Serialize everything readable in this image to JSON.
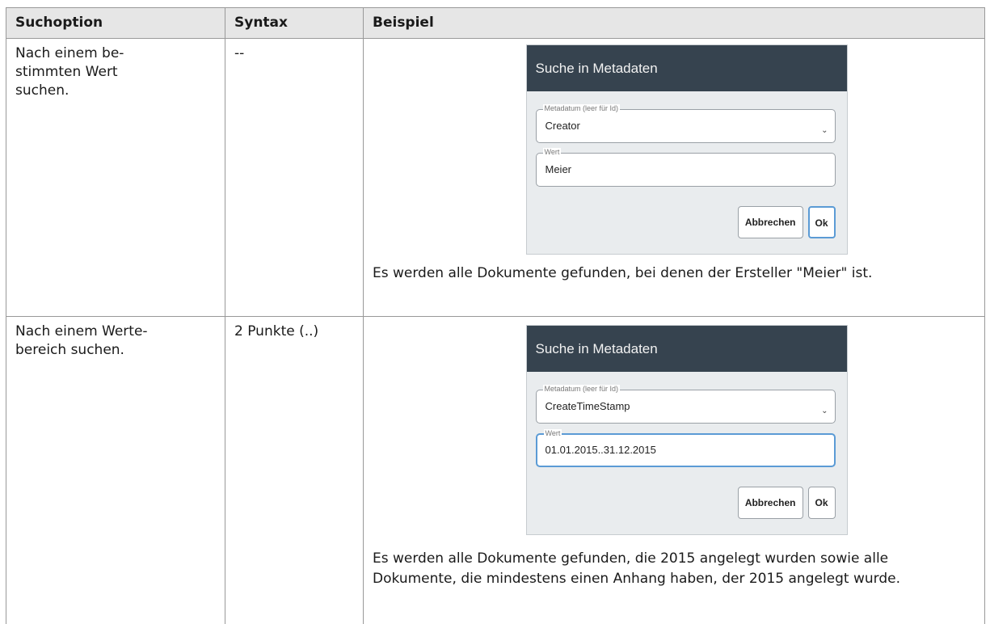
{
  "table": {
    "headers": [
      "Suchoption",
      "Syntax",
      "Beispiel"
    ],
    "rows": [
      {
        "option": "Nach einem be-\nstimmten Wert\nsuchen.",
        "syntax": "--",
        "dialog": {
          "title": "Suche in Metadaten",
          "field1_legend": "Metadatum (leer für Id)",
          "field1_value": "Creator",
          "field2_legend": "Wert",
          "field2_value": "Meier",
          "cancel_label": "Abbrechen",
          "ok_label": "Ok"
        },
        "result": "Es werden alle Dokumente gefunden, bei denen der Ersteller \"Meier\" ist."
      },
      {
        "option": "Nach einem Werte-\nbereich suchen.",
        "syntax": "2 Punkte (..)",
        "dialog": {
          "title": "Suche in Metadaten",
          "field1_legend": "Metadatum (leer für Id)",
          "field1_value": "CreateTimeStamp",
          "field2_legend": "Wert",
          "field2_value": "01.01.2015..31.12.2015",
          "cancel_label": "Abbrechen",
          "ok_label": "Ok"
        },
        "result": "Es werden alle Dokumente gefunden, die 2015 angelegt wurden sowie alle Dokumente, die mindestens einen Anhang haben, der 2015 angelegt wurde."
      }
    ]
  },
  "icons": {
    "dropdown": "chevron-down-icon"
  },
  "colors": {
    "dialog_title_bg": "#36434f",
    "dialog_bg": "#e9ecee",
    "focus": "#5b9bd5",
    "header_bg": "#e6e6e6"
  }
}
